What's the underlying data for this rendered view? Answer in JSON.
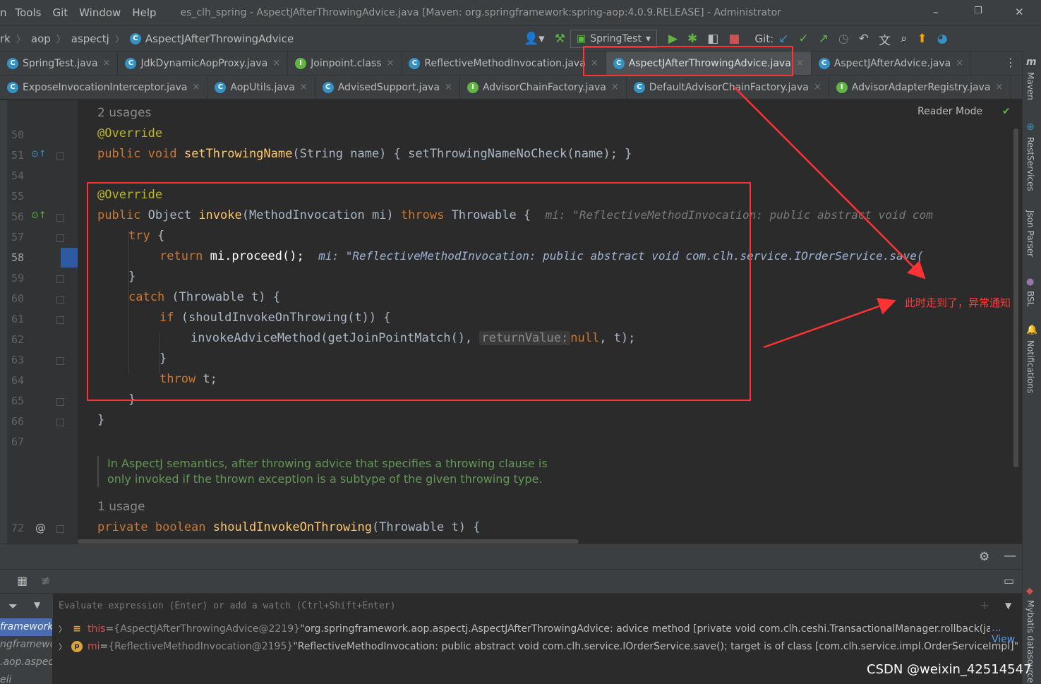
{
  "menu": [
    "Tools",
    "Git",
    "Window",
    "Help"
  ],
  "menu_cut": "n",
  "window_title": "es_clh_spring - AspectJAfterThrowingAdvice.java [Maven: org.springframework:spring-aop:4.0.9.RELEASE] - Administrator",
  "window_controls": [
    "–",
    "❐",
    "✕"
  ],
  "breadcrumbs": [
    "rk",
    "aop",
    "aspectj",
    "AspectJAfterThrowingAdvice"
  ],
  "toolbar": {
    "run_config": "SpringTest",
    "git_label": "Git:"
  },
  "tabs_row1": [
    {
      "label": "SpringTest.java",
      "icon": "C"
    },
    {
      "label": "JdkDynamicAopProxy.java",
      "icon": "C"
    },
    {
      "label": "Joinpoint.class",
      "icon": "I"
    },
    {
      "label": "ReflectiveMethodInvocation.java",
      "icon": "C"
    },
    {
      "label": "AspectJAfterThrowingAdvice.java",
      "icon": "C"
    },
    {
      "label": "AspectJAfterAdvice.java",
      "icon": "C"
    }
  ],
  "tabs_row2": [
    {
      "label": "ExposeInvocationInterceptor.java",
      "icon": "C"
    },
    {
      "label": "AopUtils.java",
      "icon": "C"
    },
    {
      "label": "AdvisedSupport.java",
      "icon": "C"
    },
    {
      "label": "AdvisorChainFactory.java",
      "icon": "I"
    },
    {
      "label": "DefaultAdvisorChainFactory.java",
      "icon": "C"
    },
    {
      "label": "AdvisorAdapterRegistry.java",
      "icon": "I"
    }
  ],
  "tab_close": "×",
  "editor": {
    "reader_mode": "Reader Mode",
    "usages_top": "2 usages",
    "usages_bottom": "1 usage",
    "line_numbers": [
      "50",
      "51",
      "54",
      "55",
      "56",
      "57",
      "58",
      "59",
      "60",
      "61",
      "62",
      "63",
      "64",
      "65",
      "66",
      "67",
      "72"
    ],
    "l50": "@Override",
    "l51_kw": "public void ",
    "l51_fn": "setThrowingName",
    "l51_rest": "(String name) { setThrowingNameNoCheck(name); }",
    "l55": "@Override",
    "l56_kw1": "public ",
    "l56_type": "Object ",
    "l56_fn": "invoke",
    "l56_params": "(MethodInvocation mi) ",
    "l56_kw2": "throws ",
    "l56_rest": "Throwable {",
    "l56_hint": "mi: \"ReflectiveMethodInvocation: public abstract void com",
    "l57_kw": "try ",
    "l57_rest": "{",
    "l58_kw": "return ",
    "l58_rest": "mi.proceed();",
    "l58_hint": "mi: \"ReflectiveMethodInvocation: public abstract void com.clh.service.IOrderService.save(",
    "l59": "}",
    "l60_kw": "catch ",
    "l60_rest": "(Throwable t) {",
    "l61_kw": "if ",
    "l61_rest": "(shouldInvokeOnThrowing(t)) {",
    "l62_a": "invokeAdviceMethod(getJoinPointMatch(), ",
    "l62_inlay": "returnValue:",
    "l62_kw": "null",
    "l62_b": ", t);",
    "l63": "}",
    "l64_kw": "throw ",
    "l64_rest": "t;",
    "l65": "}",
    "l66": "}",
    "doc": "In AspectJ semantics, after throwing advice that specifies a throwing clause is only invoked if the thrown exception is a subtype of the given throwing type.",
    "l72_kw": "private boolean ",
    "l72_fn": "shouldInvokeOnThrowing",
    "l72_rest": "(Throwable t) {"
  },
  "annotation": "此时走到了，异常通知",
  "right_tools": [
    "Maven",
    "RestServices",
    "Json Parser",
    "BSL",
    "Notifications",
    "Mybatis datasource"
  ],
  "debug": {
    "eval_placeholder": "Evaluate expression (Enter) or add a watch (Ctrl+Shift+Enter)",
    "frames": [
      "framework.",
      "ngframewor",
      ".aop.aspec",
      "eli"
    ],
    "vars": [
      {
        "badge": "≡",
        "name": "this",
        "eq": " = ",
        "type": "{AspectJAfterThrowingAdvice@2219}",
        "value": " \"org.springframework.aop.aspectj.AspectJAfterThrowingAdvice: advice method [private void com.clh.ceshi.TransactionalManager.rollback(java.lan",
        "tail": "... View"
      },
      {
        "badge": "p",
        "name": "mi",
        "eq": " = ",
        "type": "{ReflectiveMethodInvocation@2195}",
        "value": " \"ReflectiveMethodInvocation: public abstract void com.clh.service.IOrderService.save(); target is of class [com.clh.service.impl.OrderServiceImpl]\"",
        "tail": ""
      }
    ]
  },
  "watermark": "CSDN @weixin_42514547"
}
